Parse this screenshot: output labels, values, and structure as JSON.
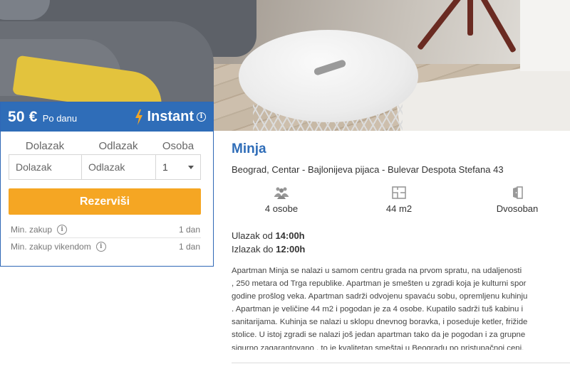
{
  "booking": {
    "price": "50 €",
    "per_day": "Po danu",
    "instant_label": "Instant",
    "labels": {
      "arrival": "Dolazak",
      "departure": "Odlazak",
      "guests": "Osoba"
    },
    "inputs": {
      "arrival_placeholder": "Dolazak",
      "departure_placeholder": "Odlazak",
      "guests_value": "1"
    },
    "reserve_label": "Rezerviši",
    "min_stay": {
      "label": "Min. zakup",
      "value": "1 dan"
    },
    "min_stay_weekend": {
      "label": "Min. zakup vikendom",
      "value": "1 dan"
    },
    "colors": {
      "header": "#2f6db8",
      "button": "#f5a623"
    }
  },
  "listing": {
    "title": "Minja",
    "address": "Beograd, Centar - Bajlonijeva pijaca - Bulevar Despota Stefana 43",
    "features": [
      {
        "icon": "people-icon",
        "label": "4 osobe"
      },
      {
        "icon": "floor-plan-icon",
        "label": "44 m2"
      },
      {
        "icon": "door-icon",
        "label": "Dvosoban"
      }
    ],
    "checkin": {
      "label": "Ulazak od",
      "time": "14:00h"
    },
    "checkout": {
      "label": "Izlazak do",
      "time": "12:00h"
    },
    "description_lines": [
      "Apartman Minja se nalazi u samom centru grada na prvom spratu, na udaljenosti",
      ", 250 metara od Trga republike. Apartman je smešten u zgradi koja je kulturni spor",
      "godine prošlog veka. Apartman sadrži odvojenu spavaću sobu, opremljenu kuhinju",
      ". Apartman je veličine 44 m2 i pogodan je za 4 osobe. Kupatilo sadrži tuš kabinu i",
      "sanitarijama. Kuhinja se nalazi u sklopu dnevnog boravka, i poseduje ketler, frižide",
      "stolice. U istoj zgradi se nalazi još jedan apartman tako da je pogodan i za grupne",
      "sigurno zagarantovano , to je kvalitetan smeštaj u Beogradu po pristupačnoj ceni."
    ]
  }
}
